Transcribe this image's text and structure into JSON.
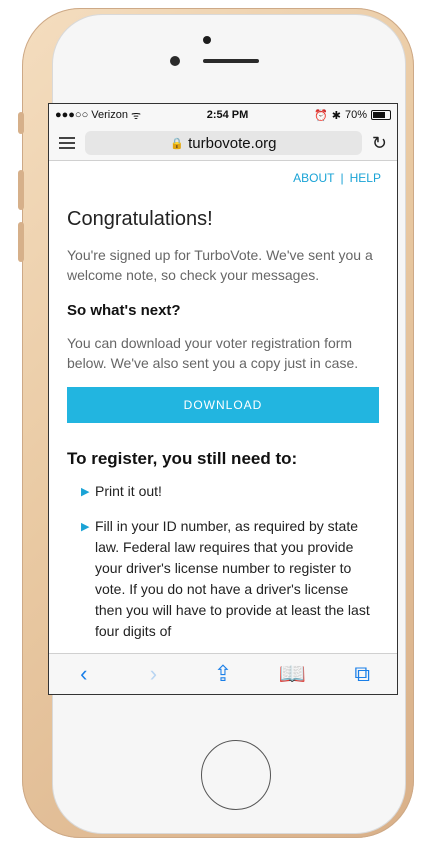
{
  "status": {
    "carrier": "●●●○○ Verizon",
    "wifi_icon": "wifi-icon",
    "time": "2:54 PM",
    "alarm_icon": "alarm-icon",
    "bluetooth_icon": "bluetooth-icon",
    "battery": "70%"
  },
  "browser": {
    "url": "turbovote.org"
  },
  "nav": {
    "about": "ABOUT",
    "separator": "|",
    "help": "HELP"
  },
  "page": {
    "title": "Congratulations!",
    "intro": "You're signed up for TurboVote. We've sent you a welcome note, so check your messages.",
    "next_heading": "So what's next?",
    "next_text": "You can download your voter registration form below. We've also sent you a copy just in case.",
    "download_label": "DOWNLOAD",
    "register_heading": "To register, you still need to:",
    "steps": [
      "Print it out!",
      "Fill in your ID number, as required by state law. Federal law requires that you provide your driver's license number to register to vote. If you do not have a driver's license then you will have to provide at least the last four digits of"
    ]
  },
  "colors": {
    "accent": "#22b5e0",
    "link": "#1aa3d6",
    "safari_blue": "#1a7fe8"
  }
}
